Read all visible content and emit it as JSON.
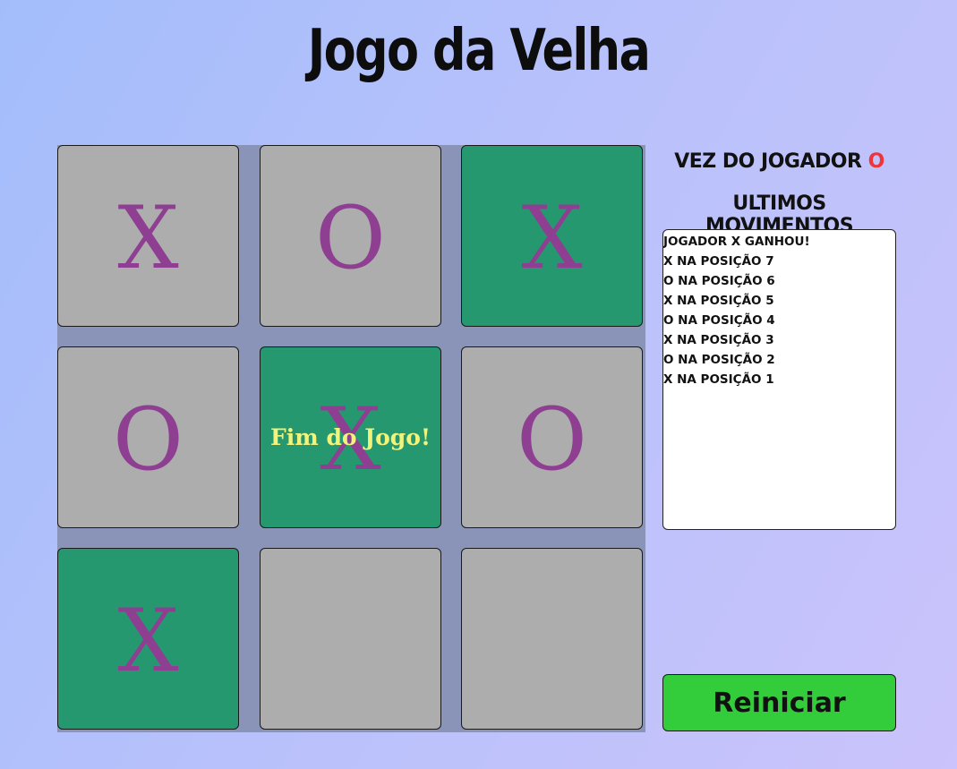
{
  "title": "Jogo da Velha",
  "board": {
    "cells": [
      {
        "mark": "X",
        "winning": false
      },
      {
        "mark": "O",
        "winning": false
      },
      {
        "mark": "X",
        "winning": true
      },
      {
        "mark": "O",
        "winning": false
      },
      {
        "mark": "X",
        "winning": true
      },
      {
        "mark": "O",
        "winning": false
      },
      {
        "mark": "X",
        "winning": true
      },
      {
        "mark": "",
        "winning": false
      },
      {
        "mark": "",
        "winning": false
      }
    ],
    "game_over_text": "Fim do Jogo!"
  },
  "turn": {
    "label": "VEZ DO JOGADOR",
    "player": "O"
  },
  "moves": {
    "title": "ULTIMOS MOVIMENTOS",
    "items": [
      "JOGADOR X GANHOU!",
      "X NA POSIÇÃO 7",
      "O NA POSIÇÃO 6",
      "X NA POSIÇÃO 5",
      "O NA POSIÇÃO 4",
      "X NA POSIÇÃO 3",
      "O NA POSIÇÃO 2",
      "X NA POSIÇÃO 1"
    ]
  },
  "restart_label": "Reiniciar",
  "colors": {
    "cell": "#adadad",
    "winning_cell": "#269870",
    "mark": "#8e3f92",
    "game_over_text": "#f1f37a",
    "current_player": "#f0343c",
    "restart_button": "#33cc3a"
  }
}
